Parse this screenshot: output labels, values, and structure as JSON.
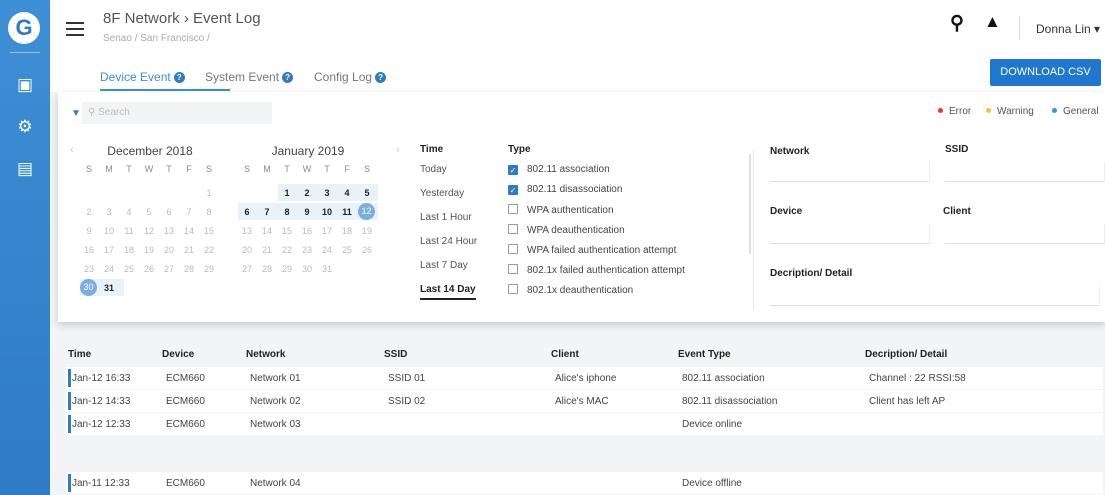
{
  "rail": {
    "logo": "G",
    "icons": [
      "monitor-icon",
      "gear-icon",
      "report-icon"
    ]
  },
  "header": {
    "title": "8F Network  ›  Event Log",
    "breadcrumb": "Senao / San Francisco /",
    "user": "Donna Lin ▾"
  },
  "tabs": [
    {
      "label": "Device Event"
    },
    {
      "label": "System Event"
    },
    {
      "label": "Config Log"
    }
  ],
  "download_label": "DOWNLOAD CSV",
  "search": {
    "placeholder": "Search"
  },
  "legend": [
    {
      "label": "Error",
      "color": "#e53935"
    },
    {
      "label": "Warning",
      "color": "#f5c242"
    },
    {
      "label": "General",
      "color": "#3d8fd6"
    }
  ],
  "calendar": {
    "dow": [
      "S",
      "M",
      "T",
      "W",
      "T",
      "F",
      "S"
    ],
    "months": [
      {
        "title": "December 2018",
        "weeks": [
          [
            "",
            "",
            "",
            "",
            "",
            "",
            "1"
          ],
          [
            "2",
            "3",
            "4",
            "5",
            "6",
            "7",
            "8"
          ],
          [
            "9",
            "10",
            "11",
            "12",
            "13",
            "14",
            "15"
          ],
          [
            "16",
            "17",
            "18",
            "19",
            "20",
            "21",
            "22"
          ],
          [
            "23",
            "24",
            "25",
            "26",
            "27",
            "28",
            "29"
          ],
          [
            "30",
            "31",
            "",
            "",
            "",
            "",
            ""
          ]
        ]
      },
      {
        "title": "January 2019",
        "weeks": [
          [
            "",
            "",
            "1",
            "2",
            "3",
            "4",
            "5"
          ],
          [
            "6",
            "7",
            "8",
            "9",
            "10",
            "11",
            "12"
          ],
          [
            "13",
            "14",
            "15",
            "16",
            "17",
            "18",
            "19"
          ],
          [
            "20",
            "21",
            "22",
            "23",
            "24",
            "25",
            "26"
          ],
          [
            "27",
            "28",
            "29",
            "30",
            "31",
            "",
            ""
          ]
        ]
      }
    ]
  },
  "time": {
    "title": "Time",
    "options": [
      "Today",
      "Yesterday",
      "Last 1 Hour",
      "Last 24 Hour",
      "Last 7 Day",
      "Last 14 Day"
    ],
    "selected": "Last 14 Day"
  },
  "type": {
    "title": "Type",
    "options": [
      {
        "label": "802.11 association",
        "checked": true
      },
      {
        "label": "802.11 disassociation",
        "checked": true
      },
      {
        "label": "WPA authentication",
        "checked": false
      },
      {
        "label": "WPA deauthentication",
        "checked": false
      },
      {
        "label": "WPA failed authentication attempt",
        "checked": false
      },
      {
        "label": "802.1x failed authentication attempt",
        "checked": false
      },
      {
        "label": "802.1x deauthentication",
        "checked": false
      }
    ]
  },
  "fields": {
    "network": "Network",
    "ssid": "SSID",
    "device": "Device",
    "client": "Client",
    "detail": "Decription/ Detail"
  },
  "table": {
    "headers": [
      "Time",
      "Device",
      "Network",
      "SSID",
      "Client",
      "Event Type",
      "Decription/ Detail"
    ],
    "rows": [
      [
        "Jan-12 16:33",
        "ECM660",
        "Network 01",
        "SSID 01",
        "Alice's iphone",
        "802.11 association",
        "Channel : 22   RSSI:58"
      ],
      [
        "Jan-12 14:33",
        "ECM660",
        "Network 02",
        "SSID 02",
        "Alice's MAC",
        "802.11 disassociation",
        "Client has left AP"
      ],
      [
        "Jan-12 12:33",
        "ECM660",
        "Network 03",
        "",
        "",
        "Device online",
        ""
      ],
      [
        "Jan-11 12:33",
        "ECM660",
        "Network 04",
        "",
        "",
        "Device offline",
        ""
      ]
    ]
  }
}
